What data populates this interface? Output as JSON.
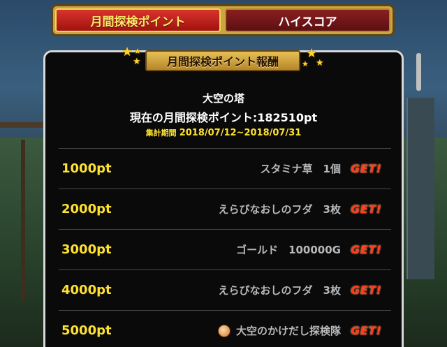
{
  "tabs": [
    {
      "label": "月間探検ポイント",
      "active": true
    },
    {
      "label": "ハイスコア",
      "active": false
    }
  ],
  "banner": {
    "title": "月間探検ポイント報酬"
  },
  "info": {
    "place": "大空の塔",
    "points_line": "現在の月間探検ポイント:182510pt",
    "period_label": "集計期間",
    "period_value": "2018/07/12~2018/07/31"
  },
  "rewards": [
    {
      "points": "1000pt",
      "item": "スタミナ草　1個",
      "get": "GET!",
      "icon": ""
    },
    {
      "points": "2000pt",
      "item": "えらびなおしのフダ　3枚",
      "get": "GET!",
      "icon": ""
    },
    {
      "points": "3000pt",
      "item": "ゴールド　100000G",
      "get": "GET!",
      "icon": ""
    },
    {
      "points": "4000pt",
      "item": "えらびなおしのフダ　3枚",
      "get": "GET!",
      "icon": ""
    },
    {
      "points": "5000pt",
      "item": "大空のかけだし探検隊",
      "get": "GET!",
      "icon": "onion-icon"
    }
  ],
  "colors": {
    "accent_gold": "#ffe230",
    "get_red": "#ff3a1a",
    "tab_red": "#a1120f"
  }
}
